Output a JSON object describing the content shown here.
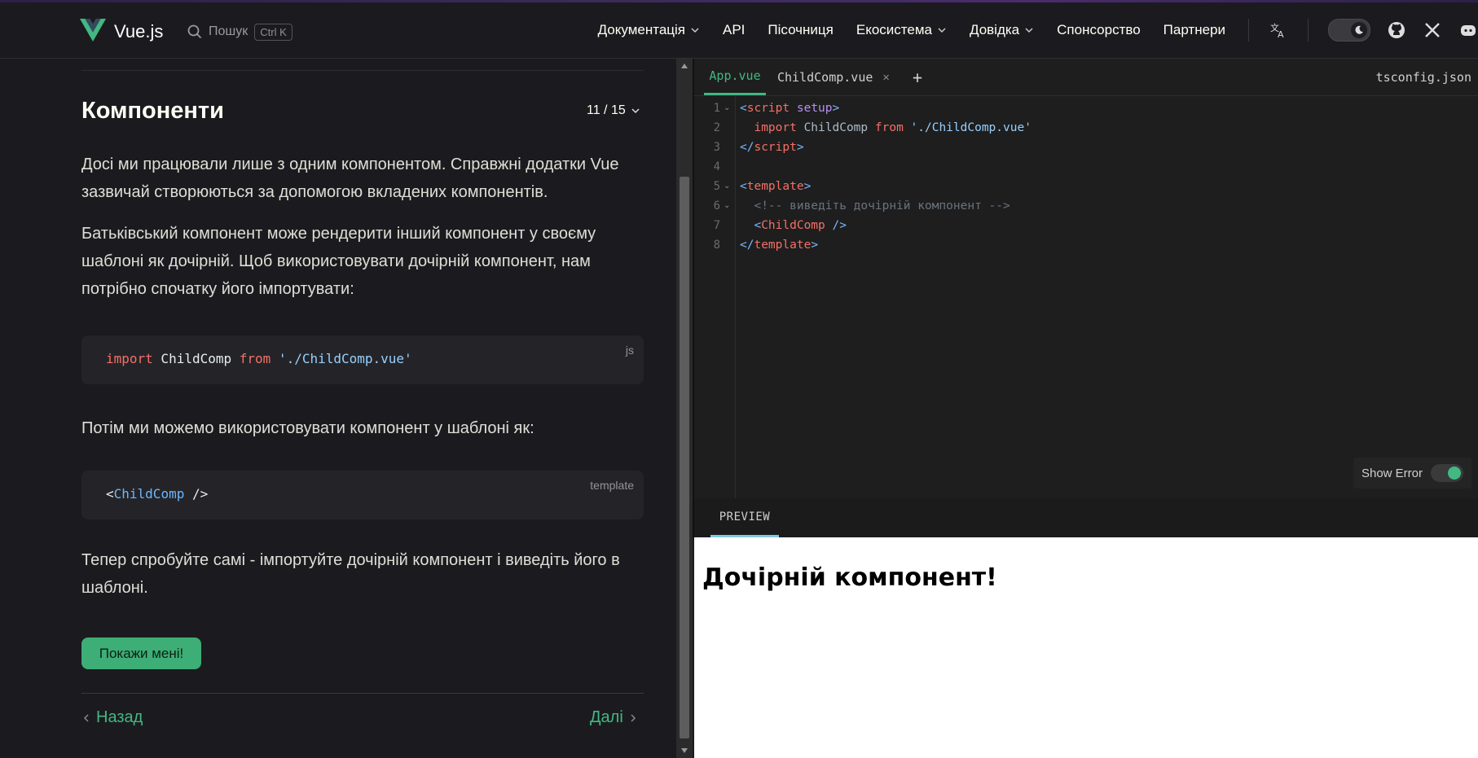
{
  "nav": {
    "brand": "Vue.js",
    "search_label": "Пошук",
    "search_shortcut": "Ctrl K",
    "items": [
      {
        "label": "Документація",
        "dropdown": true
      },
      {
        "label": "API",
        "dropdown": false
      },
      {
        "label": "Пісочниця",
        "dropdown": false
      },
      {
        "label": "Екосистема",
        "dropdown": true
      },
      {
        "label": "Довідка",
        "dropdown": true
      },
      {
        "label": "Спонсорство",
        "dropdown": false
      },
      {
        "label": "Партнери",
        "dropdown": false
      }
    ],
    "accent": "#42b883"
  },
  "lesson": {
    "title": "Компоненти",
    "progress": "11 / 15",
    "p1": "Досі ми працювали лише з одним компонентом. Справжні додатки Vue зазвичай створюються за допомогою вкладених компонентів.",
    "p2": "Батьківський компонент може рендерити інший компонент у своєму шаблоні як дочірній. Щоб використовувати дочірній компонент, нам потрібно спочатку його імпортувати:",
    "code1": {
      "lang": "js",
      "kw_import": "import",
      "ident": " ChildComp ",
      "kw_from": "from",
      "str": " './ChildComp.vue'"
    },
    "p3": "Потім ми можемо використовувати компонент у шаблоні як:",
    "code2": {
      "lang": "template",
      "open": "<",
      "tag": "ChildComp",
      "close": " />"
    },
    "p4": "Тепер спробуйте самі - імпортуйте дочірній компонент і виведіть його в шаблоні.",
    "show_button": "Покажи мені!",
    "prev": "Назад",
    "next": "Далі"
  },
  "editor": {
    "tabs": [
      {
        "label": "App.vue",
        "active": true
      },
      {
        "label": "ChildComp.vue",
        "active": false
      }
    ],
    "add_tab": "+",
    "tsconfig": "tsconfig.json",
    "line_numbers": [
      "1",
      "2",
      "3",
      "4",
      "5",
      "6",
      "7",
      "8"
    ],
    "lines": {
      "l1a": "<",
      "l1b": "script",
      "l1c": " setup",
      "l1d": ">",
      "l2a": "  import",
      "l2b": " ChildComp ",
      "l2c": "from",
      "l2d": " './ChildComp.vue'",
      "l3a": "</",
      "l3b": "script",
      "l3c": ">",
      "l5a": "<",
      "l5b": "template",
      "l5c": ">",
      "l6": "  <!-- виведіть дочірній компонент -->",
      "l7a": "  <",
      "l7b": "ChildComp",
      "l7c": " />",
      "l8a": "</",
      "l8b": "template",
      "l8c": ">"
    },
    "show_error_label": "Show Error",
    "show_error_on": true
  },
  "preview": {
    "tab": "PREVIEW",
    "heading": "Дочірній компонент!"
  }
}
